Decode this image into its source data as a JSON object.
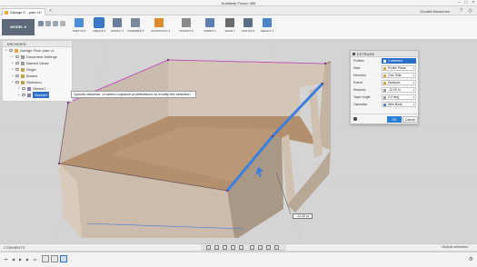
{
  "app": {
    "title": "Autodesk Fusion 360"
  },
  "tab": {
    "label": "Garage fl ...plan v1*"
  },
  "user": {
    "name": "Donald Mesarmes"
  },
  "workspace": {
    "label": "MODEL ▾"
  },
  "toolbar": {
    "groups": [
      {
        "label": "SKETCH ▾",
        "icon": "sketch-icon",
        "color": "#4d8fd6"
      },
      {
        "label": "CREATE ▾",
        "icon": "create-icon",
        "color": "#3c78c8"
      },
      {
        "label": "MODIFY ▾",
        "icon": "modify-icon",
        "color": "#6a7ea0"
      },
      {
        "label": "ASSEMBLE ▾",
        "icon": "assemble-icon",
        "color": "#7a8a9a"
      },
      {
        "label": "CONSTRUCT ▾",
        "icon": "construct-icon",
        "color": "#e08a2e"
      },
      {
        "label": "INSPECT ▾",
        "icon": "inspect-icon",
        "color": "#8a8a8a"
      },
      {
        "label": "INSERT ▾",
        "icon": "insert-icon",
        "color": "#5a7fb0"
      },
      {
        "label": "MAKE ▾",
        "icon": "make-icon",
        "color": "#6b6b6b"
      },
      {
        "label": "ADD-INS ▾",
        "icon": "addins-icon",
        "color": "#5b6e86"
      },
      {
        "label": "SELECT ▾",
        "icon": "select-icon",
        "color": "#4b84c8"
      }
    ]
  },
  "browser": {
    "title": "BROWSER",
    "items": [
      {
        "label": "Garage Floor plan v1",
        "level": 0,
        "selected": false
      },
      {
        "label": "Document Settings",
        "level": 1,
        "selected": false
      },
      {
        "label": "Named Views",
        "level": 1,
        "selected": false
      },
      {
        "label": "Origin",
        "level": 1,
        "selected": false
      },
      {
        "label": "Bodies",
        "level": 1,
        "selected": false
      },
      {
        "label": "Sketches",
        "level": 1,
        "selected": false
      },
      {
        "label": "Sketch1",
        "level": 2,
        "selected": false
      },
      {
        "label": "Sketch2",
        "level": 2,
        "selected": true
      }
    ]
  },
  "tooltip": {
    "text": "Specify distance, or select coplanar profiles/faces to modify the selection"
  },
  "extrude": {
    "title": "EXTRUDE",
    "rows": [
      {
        "label": "Profiles",
        "value": "1 selected",
        "blue": true
      },
      {
        "label": "Start",
        "value": "Profile Plane",
        "blue": false
      },
      {
        "label": "Direction",
        "value": "One Side",
        "blue": false
      },
      {
        "label": "Extent",
        "value": "Distance",
        "blue": false
      },
      {
        "label": "Distance",
        "value": "-12.00 in",
        "blue": false
      },
      {
        "label": "Taper Angle",
        "value": "0.0 deg",
        "blue": false
      },
      {
        "label": "Operation",
        "value": "New Body",
        "blue": false
      }
    ],
    "ok_label": "OK",
    "cancel_label": "Cancel"
  },
  "dimension": {
    "value": "-12.00 in"
  },
  "comments": {
    "label": "COMMENTS"
  },
  "status": {
    "text": "Multiple selections"
  },
  "colors": {
    "accent": "#2a6fc9",
    "selection_edge": "#3b7fe0",
    "wall": "#c9b9a9",
    "floor": "#b48f6e"
  }
}
